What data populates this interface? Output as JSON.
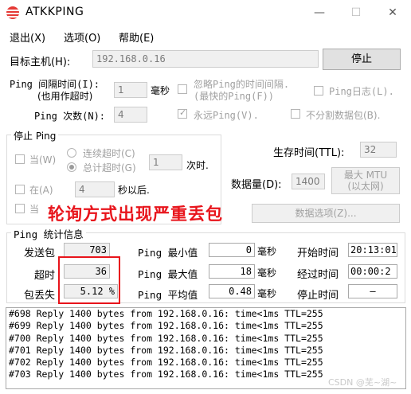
{
  "window": {
    "title": "ATKKPING",
    "minimize_glyph": "—",
    "maximize_glyph": "☐",
    "close_glyph": "✕"
  },
  "menu": [
    "退出(X)",
    "选项(O)",
    "帮助(E)"
  ],
  "target": {
    "label": "目标主机(H):",
    "value": "192.168.0.16",
    "stop_button": "停止"
  },
  "interval": {
    "label_line1": "Ping 间隔时间(I):",
    "label_line2": "(也用作超时)",
    "value": "1",
    "unit": "毫秒",
    "ignore_label_line1": "忽略Ping的时间间隔.",
    "ignore_label_line2": "(最快的Ping(F))",
    "log_label": "Ping日志(L)."
  },
  "count": {
    "label": "Ping 次数(N):",
    "value": "4",
    "forever_label": "永远Ping(V).",
    "no_fragment_label": "不分割数据包(B)."
  },
  "stop_group": {
    "title": "停止 Ping",
    "when_label": "当(W)",
    "consecutive_timeout_label": "连续超时(C)",
    "total_timeout_label": "总计超时(G)",
    "timeout_value": "1",
    "times_unit": "次时.",
    "at_label": "在(A)",
    "at_value": "4",
    "at_unit": "秒以后.",
    "third_label": "当"
  },
  "ttl": {
    "label": "生存时间(TTL):",
    "value": "32"
  },
  "data_size": {
    "label": "数据量(D):",
    "value": "1400",
    "max_mtu_line1": "最大 MTU",
    "max_mtu_line2": "(以太网)"
  },
  "data_options_button": "数据选项(Z)...",
  "stats": {
    "title": "Ping  统计信息",
    "sent_label": "发送包",
    "sent_value": "703",
    "timeout_label": "超时",
    "timeout_value": "36",
    "loss_label": "包丢失",
    "loss_value": "5.12 %",
    "min_label": "Ping 最小值",
    "min_value": "0",
    "max_label": "Ping 最大值",
    "max_value": "18",
    "avg_label": "Ping 平均值",
    "avg_value": "0.48",
    "ms_unit": "毫秒",
    "start_label": "开始时间",
    "start_value": "20:13:01",
    "elapsed_label": "经过时间",
    "elapsed_value": "00:00:2",
    "stop_label": "停止时间",
    "stop_value": "—"
  },
  "log_lines": [
    "#698 Reply 1400 bytes from 192.168.0.16: time<1ms TTL=255",
    "#699 Reply 1400 bytes from 192.168.0.16: time<1ms TTL=255",
    "#700 Reply 1400 bytes from 192.168.0.16: time<1ms TTL=255",
    "#701 Reply 1400 bytes from 192.168.0.16: time<1ms TTL=255",
    "#702 Reply 1400 bytes from 192.168.0.16: time<1ms TTL=255",
    "#703 Reply 1400 bytes from 192.168.0.16: time<1ms TTL=255"
  ],
  "annotation": "轮询方式出现严重丢包",
  "watermark": "CSDN @芜~湖~",
  "colors": {
    "annotation_red": "#e8141b",
    "icon_red": "#e53935"
  }
}
